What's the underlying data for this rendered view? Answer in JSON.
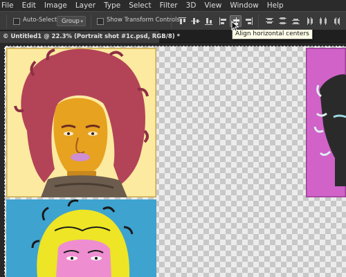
{
  "menu": [
    "File",
    "Edit",
    "Image",
    "Layer",
    "Type",
    "Select",
    "Filter",
    "3D",
    "View",
    "Window",
    "Help"
  ],
  "options": {
    "auto_select_label": "Auto-Select:",
    "auto_select_value": "Group",
    "transform_label": "Show Transform Controls"
  },
  "tooltip": "Align horizontal centers",
  "document": {
    "tab_title": "© Untitled1 @ 22.3% (Portrait shot #1c.psd, RGB/8) *",
    "close_glyph": "×"
  },
  "colors": {
    "tile1_background": "#fbeaa0",
    "tile1_hair": "#b34458",
    "tile1_face": "#e7a21f",
    "tile2_background": "#3ea3cf",
    "tile2_hair": "#ede525",
    "tile2_face": "#ee8ed0",
    "tile3_background": "#d062c8",
    "tile3_hair": "#2a2a2a"
  },
  "icons": {
    "align_buttons": [
      "align-top-edges-icon",
      "align-vertical-centers-icon",
      "align-bottom-edges-icon",
      "align-left-edges-icon",
      "align-horizontal-centers-icon",
      "align-right-edges-icon",
      "distribute-top-icon",
      "distribute-vcenter-icon",
      "distribute-bottom-icon",
      "distribute-left-icon",
      "distribute-hcenter-icon",
      "distribute-right-icon"
    ],
    "active_button": "align-horizontal-centers-icon"
  }
}
